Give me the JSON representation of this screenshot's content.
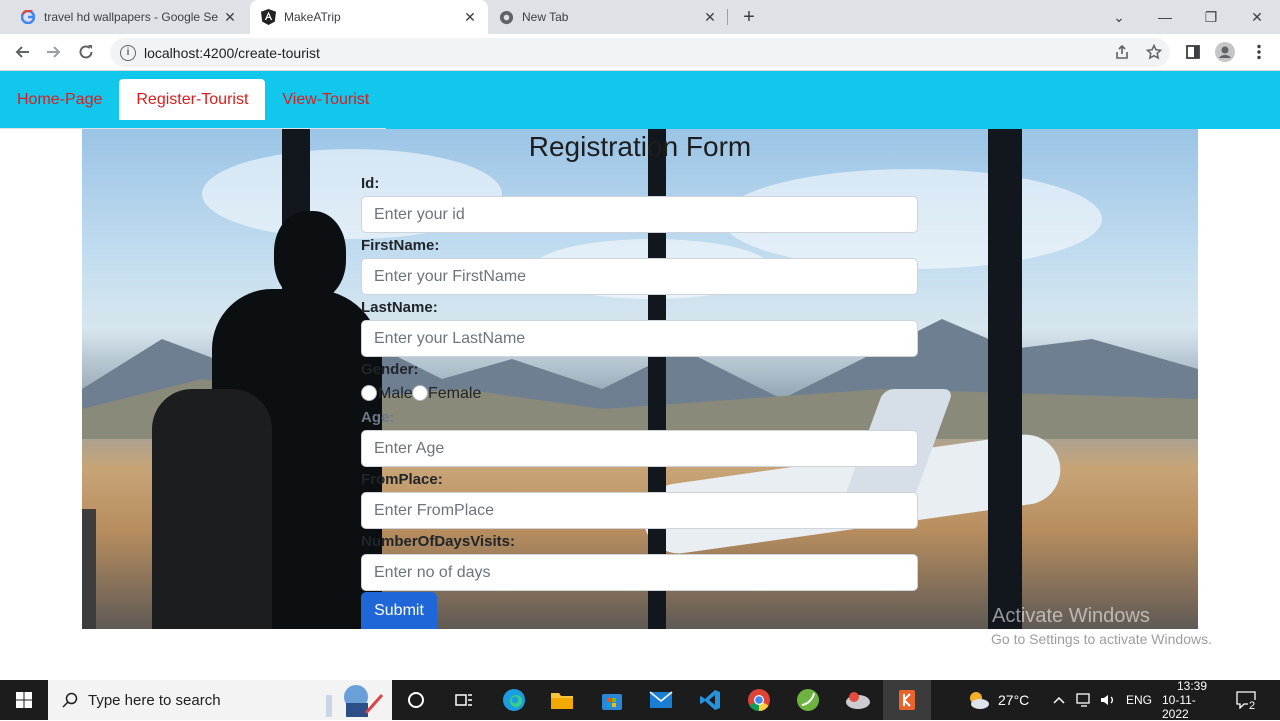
{
  "browser": {
    "tabs": [
      {
        "title": "travel hd wallpapers - Google Se",
        "icon": "google-icon"
      },
      {
        "title": "MakeATrip",
        "icon": "angular-icon"
      },
      {
        "title": "New Tab",
        "icon": "chrome-icon"
      }
    ],
    "url": "localhost:4200/create-tourist"
  },
  "nav": {
    "items": [
      "Home-Page",
      "Register-Tourist",
      "View-Tourist"
    ],
    "active": "Register-Tourist"
  },
  "form": {
    "title": "Registration Form",
    "id_label": "Id:",
    "id_placeholder": "Enter your id",
    "first_label": "FirstName:",
    "first_placeholder": "Enter your FirstName",
    "last_label": "LastName:",
    "last_placeholder": "Enter your LastName",
    "gender_label": "Gender:",
    "male": "Male",
    "female": "Female",
    "age_label": "Age:",
    "age_placeholder": "Enter Age",
    "from_label": "FromPlace:",
    "from_placeholder": "Enter FromPlace",
    "days_label": "NumberOfDaysVisits:",
    "days_placeholder": "Enter no of days",
    "submit": "Submit"
  },
  "watermark": {
    "line1": "Activate Windows",
    "line2": "Go to Settings to activate Windows."
  },
  "taskbar": {
    "search_placeholder": "Type here to search",
    "weather": "27°C",
    "lang": "ENG",
    "time": "13:39",
    "date": "10-11-2022",
    "notifications": "2"
  }
}
